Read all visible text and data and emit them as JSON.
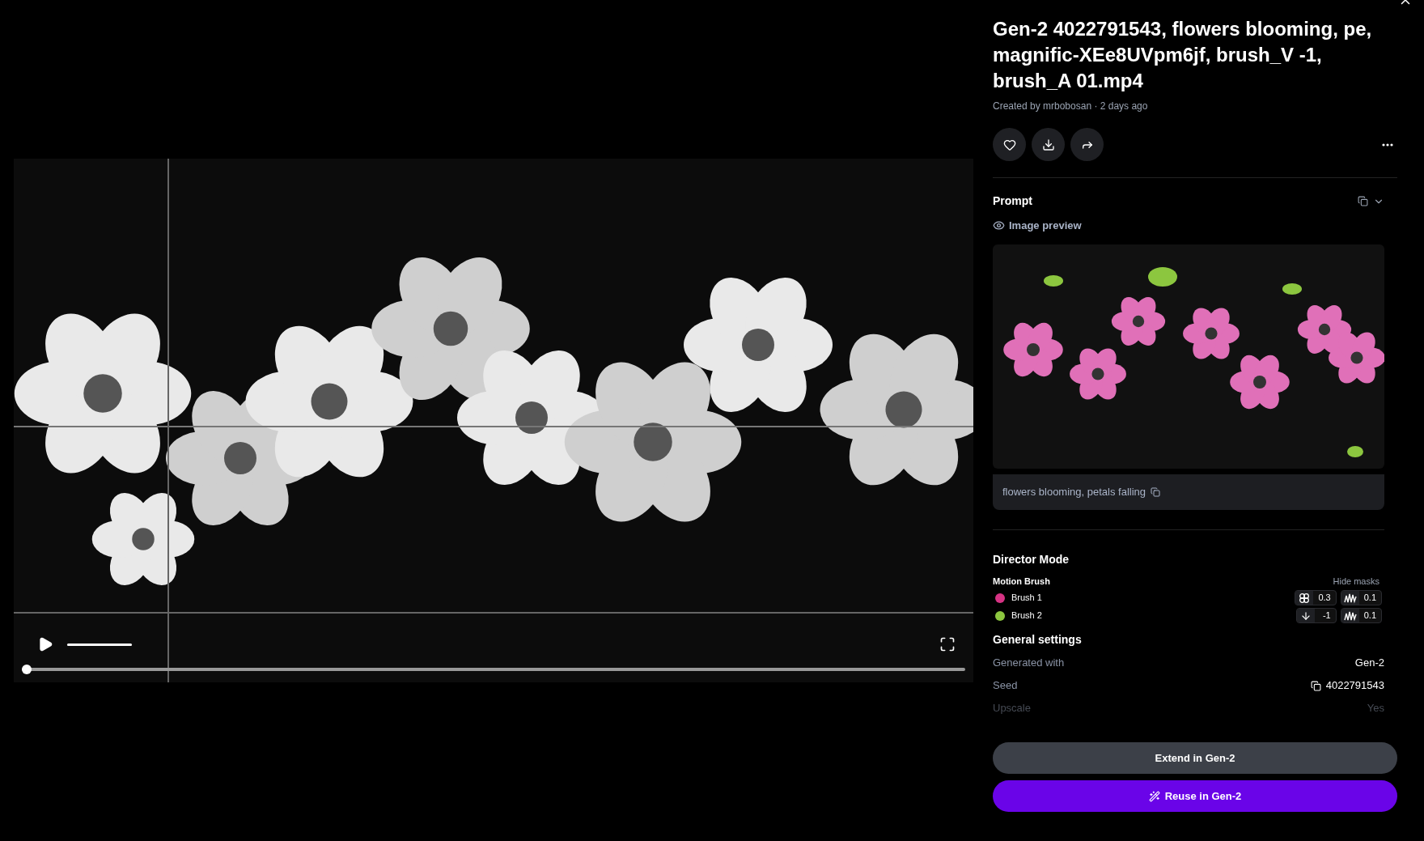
{
  "video": {
    "playing": false,
    "volume": {
      "level": 1
    },
    "progress": {
      "level": 0
    }
  },
  "details": {
    "title": "Gen-2 4022791543, flowers blooming, pe, magnific-XEe8UVpm6jf, brush_V -1, brush_A 01.mp4",
    "byline": "Created by mrbobosan · 2 days ago",
    "liked": false,
    "prompt": {
      "heading": "Prompt",
      "preview_label": "Image preview",
      "text": "flowers blooming, petals falling"
    },
    "director_mode": {
      "heading": "Director Mode",
      "subheading": "Motion Brush",
      "toggle": "Hide masks",
      "brushes": [
        {
          "name": "Brush 1",
          "color": "#d63384",
          "params": [
            {
              "kind": "proximity",
              "value": "0.3"
            },
            {
              "kind": "noise",
              "value": "0.1"
            }
          ]
        },
        {
          "name": "Brush 2",
          "color": "#8cc63f",
          "params": [
            {
              "kind": "vertical",
              "value": "-1"
            },
            {
              "kind": "noise",
              "value": "0.1"
            }
          ]
        }
      ]
    },
    "general_settings": {
      "heading": "General settings",
      "rows": [
        {
          "label": "Generated with",
          "value": "Gen-2",
          "kind": "plain",
          "faded": false
        },
        {
          "label": "Seed",
          "value": "4022791543",
          "kind": "copyable",
          "faded": false
        },
        {
          "label": "Upscale",
          "value": "Yes",
          "kind": "plain",
          "faded": true
        }
      ]
    },
    "buttons": [
      {
        "label": "Extend in Gen-2",
        "kind": "secondary"
      },
      {
        "label": "Reuse in Gen-2",
        "kind": "primary"
      }
    ]
  }
}
